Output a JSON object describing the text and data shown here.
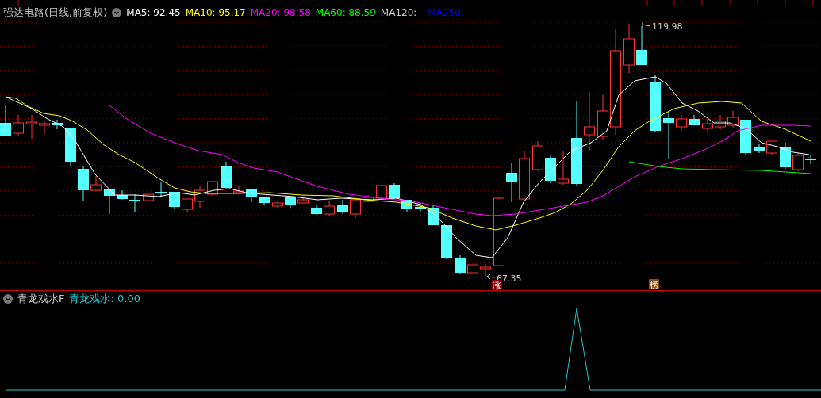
{
  "header": {
    "title": "强达电路(日线,前复权)",
    "indicators": [
      {
        "label": "MA5: 92.45",
        "color": "#ffffff"
      },
      {
        "label": "MA10: 95.17",
        "color": "#ffff00"
      },
      {
        "label": "MA20: 98.58",
        "color": "#ff00ff"
      },
      {
        "label": "MA60: 88.59",
        "color": "#00ff00"
      },
      {
        "label": "MA120: -",
        "color": "#c8c8c8"
      },
      {
        "label": "MA250: -",
        "color": "#0000ff"
      }
    ]
  },
  "price_chart": {
    "high_label": "119.98",
    "low_label": "67.35",
    "badges": [
      {
        "text": "涨",
        "color": "#8b0000"
      },
      {
        "text": "榜",
        "color": "#8b4a10"
      }
    ]
  },
  "indicator_panel": {
    "title": "青龙戏水F",
    "value": "青龙戏水: 0.00"
  }
}
